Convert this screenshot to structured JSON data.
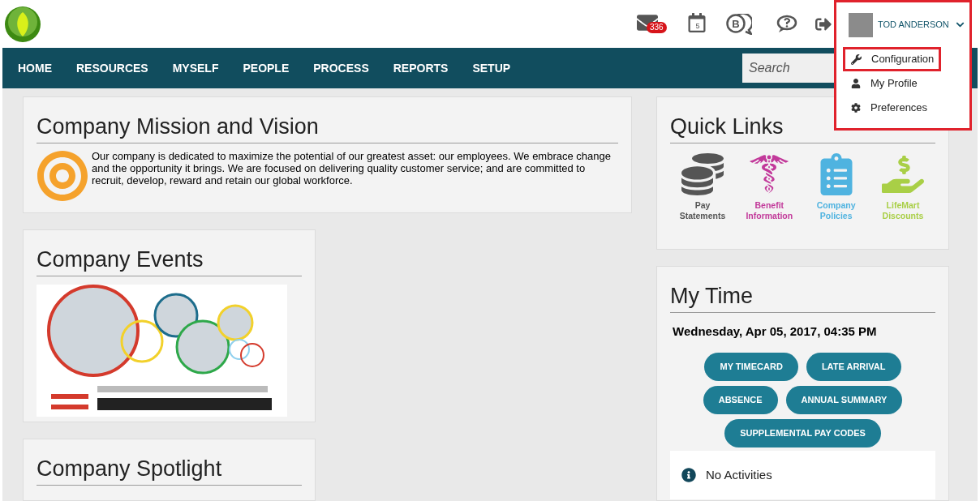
{
  "header": {
    "mail_badge": "336",
    "calendar_day": "5",
    "chat_letter": "B",
    "user_name": "TOD ANDERSON"
  },
  "user_menu": {
    "expanded": true,
    "highlighted": true,
    "items": [
      {
        "label": "Configuration",
        "kind": "wrench",
        "highlighted": true
      },
      {
        "label": "My Profile",
        "kind": "user",
        "highlighted": false
      },
      {
        "label": "Preferences",
        "kind": "gear",
        "highlighted": false
      }
    ]
  },
  "nav": {
    "items": [
      "HOME",
      "RESOURCES",
      "MYSELF",
      "PEOPLE",
      "PROCESS",
      "REPORTS",
      "SETUP"
    ],
    "search": {
      "placeholder": "Search"
    }
  },
  "mission": {
    "title": "Company Mission and Vision",
    "text": "Our company is dedicated to maximize the potential of our greatest asset:  our employees. We embrace change and the opportunity it brings. We are focused on delivering quality customer service; and are committed to recruit, develop, reward and retain our global workforce."
  },
  "events": {
    "title": "Company Events"
  },
  "spotlight": {
    "title": "Company Spotlight"
  },
  "quick_links": {
    "title": "Quick Links",
    "items": [
      {
        "label": "Pay Statements",
        "kind": "coins",
        "color": "#555555"
      },
      {
        "label": "Benefit Information",
        "kind": "caduceus",
        "color": "#c2399a"
      },
      {
        "label": "Company Policies",
        "kind": "clipboard",
        "color": "#4fb3e0"
      },
      {
        "label": "LifeMart Discounts",
        "kind": "money",
        "color": "#a9cf46"
      }
    ]
  },
  "my_time": {
    "title": "My Time",
    "datetime": "Wednesday, Apr 05, 2017, 04:35 PM",
    "buttons": [
      "MY TIMECARD",
      "LATE ARRIVAL",
      "ABSENCE",
      "ANNUAL SUMMARY",
      "SUPPLEMENTAL PAY CODES"
    ],
    "activities": "No Activities"
  }
}
